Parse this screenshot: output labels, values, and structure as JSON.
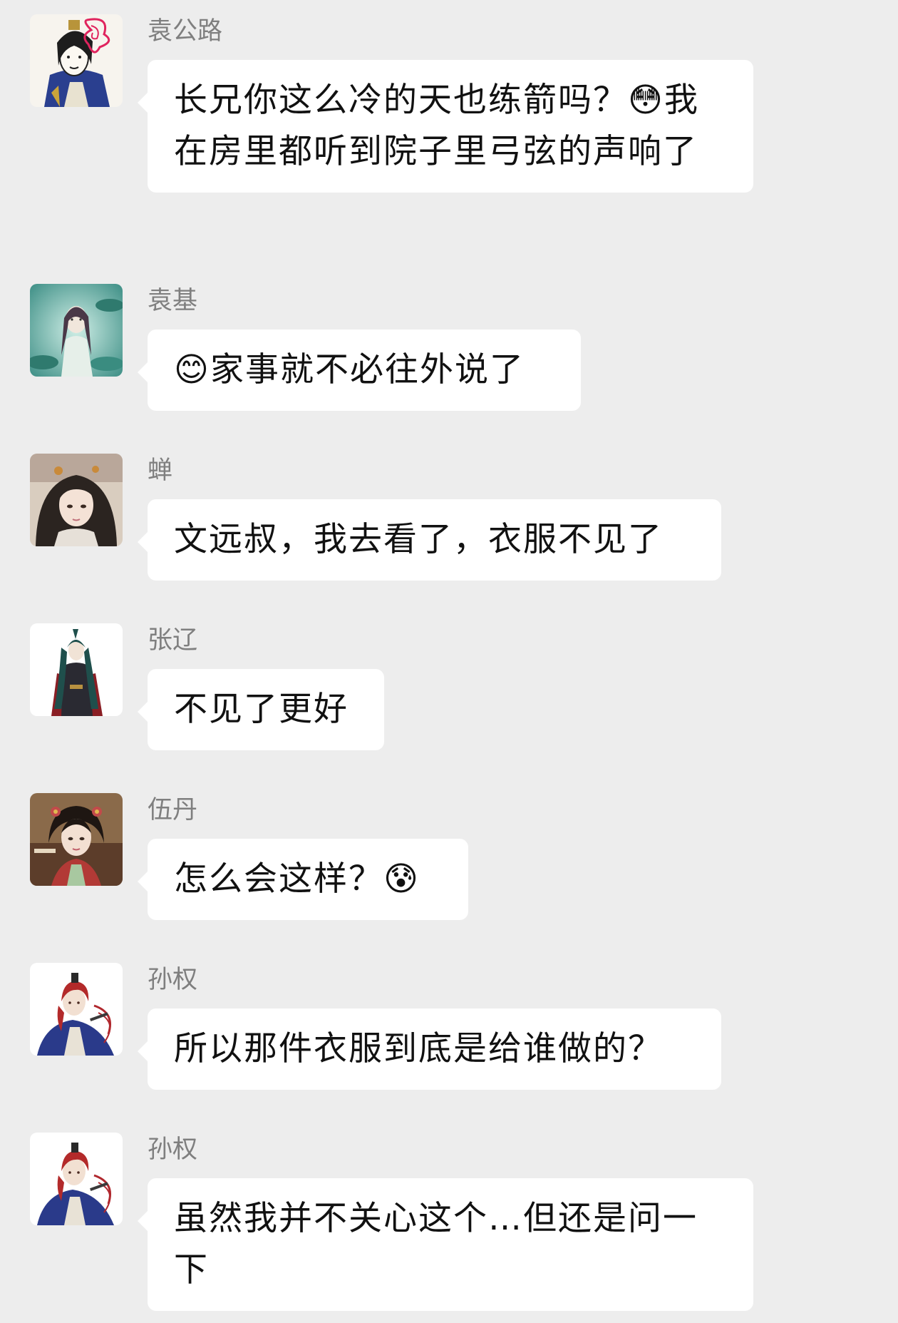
{
  "messages": [
    {
      "sender": "袁公路",
      "text": "长兄你这么冷的天也练箭吗？😳我在房里都听到院子里弓弦的声响了",
      "avatar_icon": "ink-sketch-noble-avatar-icon"
    },
    {
      "sender": "袁基",
      "text": "😊家事就不必往外说了",
      "avatar_icon": "lotus-pond-scholar-avatar-icon"
    },
    {
      "sender": "蝉",
      "text": "文远叔，我去看了，衣服不见了",
      "avatar_icon": "dark-haired-girl-avatar-icon"
    },
    {
      "sender": "张辽",
      "text": "不见了更好",
      "avatar_icon": "armored-warrior-avatar-icon"
    },
    {
      "sender": "伍丹",
      "text": "怎么会这样？😰",
      "avatar_icon": "lady-with-hairpins-avatar-icon"
    },
    {
      "sender": "孙权",
      "text": "所以那件衣服到底是给谁做的？",
      "avatar_icon": "red-haired-prince-avatar-icon"
    },
    {
      "sender": "孙权",
      "text": "虽然我并不关心这个…但还是问一下",
      "avatar_icon": "red-haired-prince-avatar-icon"
    }
  ]
}
